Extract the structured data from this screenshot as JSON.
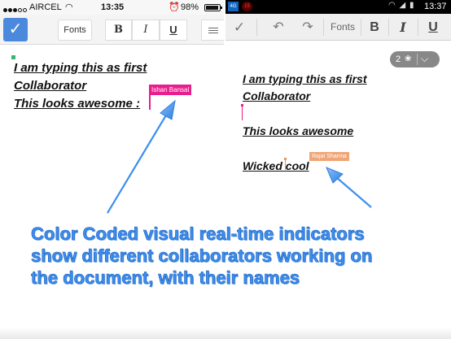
{
  "left_phone": {
    "status": {
      "carrier": "AIRCEL",
      "time": "13:35",
      "battery": "98%"
    },
    "toolbar": {
      "fonts_label": "Fonts",
      "bold_label": "B",
      "italic_label": "I",
      "underline_label": "U"
    },
    "doc_lines": [
      "I am typing this as first",
      "Collaborator",
      "This looks awesome :"
    ],
    "collaborator": {
      "name": "Ishan Bansal",
      "color": "#e91e8c"
    }
  },
  "right_phone": {
    "status": {
      "notif_1": "4G",
      "notif_2": "15",
      "time": "13:37"
    },
    "toolbar": {
      "fonts_label": "Fonts",
      "bold_label": "B",
      "italic_label": "I",
      "underline_label": "U"
    },
    "collaborators_count": "2",
    "doc_lines": [
      "I am typing this as first",
      "Collaborator",
      "This looks awesome",
      "Wicked cool"
    ],
    "collaborator": {
      "name": "Rajat Sharma",
      "color": "#f0a576"
    }
  },
  "annotation": {
    "lines": [
      "Color Coded visual real-time indicators",
      "show different collaborators working on",
      "the document, with their names"
    ],
    "color": "#3d8ff0"
  }
}
